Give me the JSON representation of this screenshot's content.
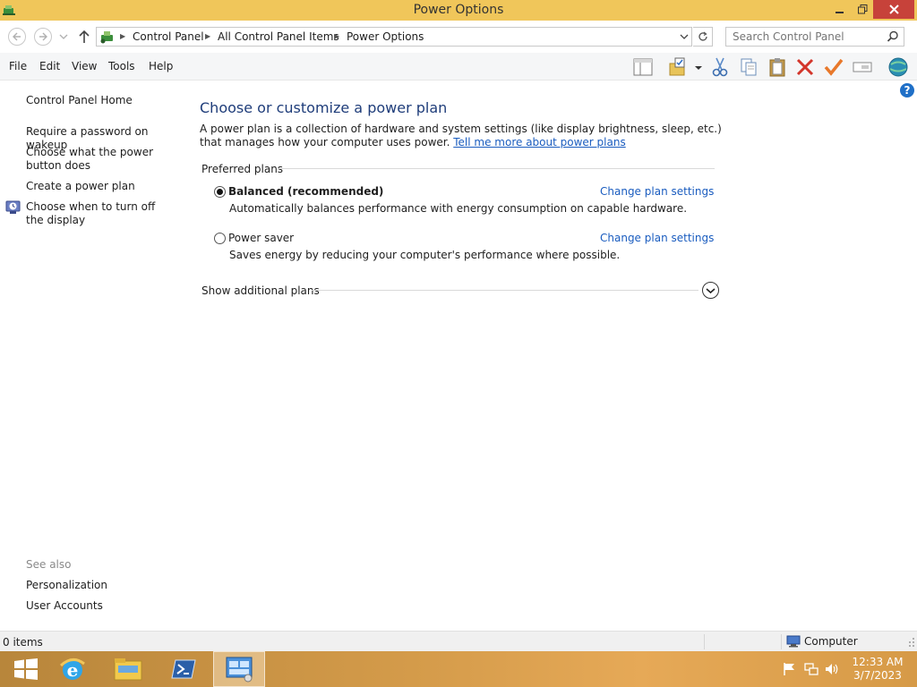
{
  "window": {
    "title": "Power Options"
  },
  "address": {
    "crumbs": [
      "Control Panel",
      "All Control Panel Items",
      "Power Options"
    ],
    "search_placeholder": "Search Control Panel"
  },
  "menu": {
    "items": [
      "File",
      "Edit",
      "View",
      "Tools",
      "Help"
    ]
  },
  "left_pane": {
    "home": "Control Panel Home",
    "tasks": [
      "Require a password on wakeup",
      "Choose what the power button does",
      "Create a power plan",
      "Choose when to turn off the display"
    ],
    "see_also_label": "See also",
    "see_also": [
      "Personalization",
      "User Accounts"
    ]
  },
  "main": {
    "heading": "Choose or customize a power plan",
    "intro": "A power plan is a collection of hardware and system settings (like display brightness, sleep, etc.) that manages how your computer uses power.",
    "intro_link": "Tell me more about power plans",
    "group_label": "Preferred plans",
    "plans": [
      {
        "name": "Balanced (recommended)",
        "description": "Automatically balances performance with energy consumption on capable hardware.",
        "link": "Change plan settings",
        "selected": true
      },
      {
        "name": "Power saver",
        "description": "Saves energy by reducing your computer's performance where possible.",
        "link": "Change plan settings",
        "selected": false
      }
    ],
    "more_label": "Show additional plans"
  },
  "status": {
    "items": "0 items",
    "location": "Computer"
  },
  "clock": {
    "time": "12:33 AM",
    "date": "3/7/2023"
  },
  "colors": {
    "titlebar": "#f0c65a",
    "close": "#c7423a",
    "link": "#1a5cbf",
    "heading": "#1f3d7a"
  }
}
